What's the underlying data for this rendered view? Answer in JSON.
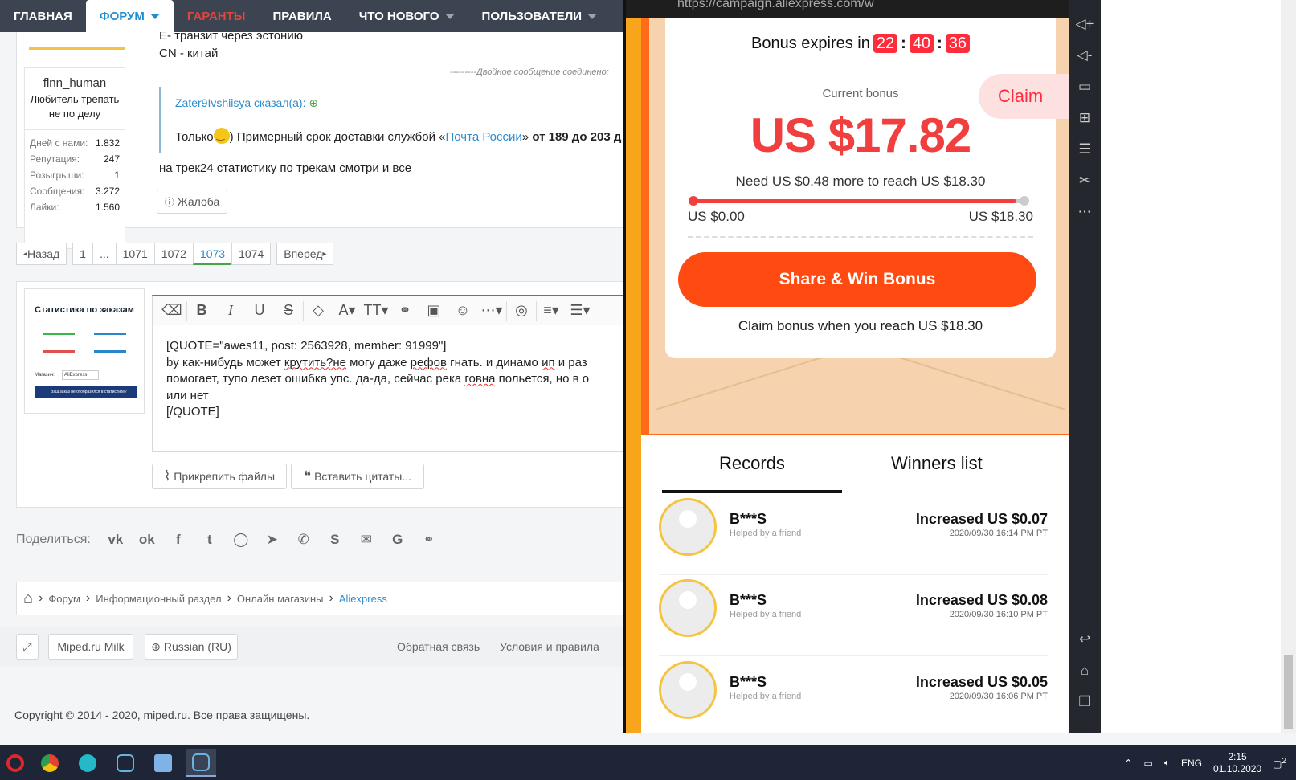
{
  "nav": {
    "items": [
      {
        "label": "ГЛАВНАЯ",
        "style": "normal",
        "caret": false
      },
      {
        "label": "ФОРУМ",
        "style": "active",
        "caret": true
      },
      {
        "label": "ГАРАНТЫ",
        "style": "red",
        "caret": false
      },
      {
        "label": "ПРАВИЛА",
        "style": "normal",
        "caret": false
      },
      {
        "label": "ЧТО НОВОГО",
        "style": "normal",
        "caret": true
      },
      {
        "label": "ПОЛЬЗОВАТЕЛИ",
        "style": "normal",
        "caret": true
      }
    ]
  },
  "post": {
    "line1": "E- транзит через эстонию",
    "line2": "CN - китай",
    "merged_note": "---------Двойное сообщение соединено:",
    "quote_author": "Zater9Ivshiisya сказал(а):",
    "quote_before": "Только",
    "quote_after": ") Примерный срок доставки службой «",
    "quote_link": "Почта России",
    "quote_tail": "» ",
    "quote_bold": "от 189 до 203 д",
    "reply": "на трек24 статистику по трекам смотри и все",
    "report_label": "Жалоба"
  },
  "user": {
    "name": "flnn_human",
    "title": "Любитель трепать не по делу",
    "stats": [
      {
        "key": "Дней с нами:",
        "value": "1.832"
      },
      {
        "key": "Репутация:",
        "value": "247"
      },
      {
        "key": "Розыгрыши:",
        "value": "1"
      },
      {
        "key": "Сообщения:",
        "value": "3.272"
      },
      {
        "key": "Лайки:",
        "value": "1.560"
      }
    ]
  },
  "pager": {
    "prev": "Назад",
    "pages": [
      "1",
      "...",
      "1071",
      "1072",
      "1073",
      "1074"
    ],
    "current": "1073",
    "next": "Вперед"
  },
  "thumb": {
    "title": "Статистика по заказам",
    "store_label": "Магазин:",
    "store_value": "AliExpress",
    "button": "Ваш заказ не отобразился в статистике?"
  },
  "editor": {
    "line1": "[QUOTE=\"awes11, post: 2563928, member: 91999\"]",
    "line2_a": "by как-нибудь может ",
    "line2_spell1": "крутить?не",
    "line2_b": " могу даже ",
    "line2_spell2": "рефов",
    "line2_c": " гнать. и динамо ",
    "line2_spell3": "ип",
    "line2_d": " и раз",
    "line3_a": "помогает, тупо лезет ошибка упс. да-да, сейчас река ",
    "line3_spell": "говна",
    "line3_b": " польется, но в о",
    "line4": "или нет",
    "line5": "[/QUOTE]",
    "attach_label": "Прикрепить файлы",
    "insert_quotes_label": "Вставить цитаты..."
  },
  "share": {
    "label": "Поделиться:",
    "icons": [
      "vk-icon",
      "odnoklassniki-icon",
      "facebook-icon",
      "twitter-icon",
      "whatsapp-icon",
      "telegram-icon",
      "viber-icon",
      "skype-icon",
      "email-icon",
      "google-icon",
      "link-icon"
    ]
  },
  "breadcrumb": [
    "Форум",
    "Информационный раздел",
    "Онлайн магазины",
    "Aliexpress"
  ],
  "footer": {
    "style_label": "Miped.ru Milk",
    "lang_label": "Russian (RU)",
    "feedback": "Обратная связь",
    "terms": "Условия и правила",
    "copyright": "Copyright © 2014 - 2020, miped.ru. Все права защищены."
  },
  "phone": {
    "url": "https://campaign.aliexpress.com/w",
    "bonus_expires": "Bonus expires in",
    "timer": [
      "22",
      "40",
      "36"
    ],
    "claim": "Claim",
    "current_bonus_label": "Current bonus",
    "amount": "US $17.82",
    "need_text": "Need US $0.48 more to reach US $18.30",
    "range_min": "US $0.00",
    "range_max": "US $18.30",
    "progress": 0.974,
    "share_button": "Share & Win Bonus",
    "claim_when": "Claim bonus when you reach US $18.30",
    "tabs": [
      "Records",
      "Winners list"
    ],
    "records": [
      {
        "name": "B***S",
        "sub": "Helped by a friend",
        "increase": "Increased US $0.07",
        "time": "2020/09/30 16:14 PM PT"
      },
      {
        "name": "B***S",
        "sub": "Helped by a friend",
        "increase": "Increased US $0.08",
        "time": "2020/09/30 16:10 PM PT"
      },
      {
        "name": "B***S",
        "sub": "Helped by a friend",
        "increase": "Increased US $0.05",
        "time": "2020/09/30 16:06 PM PT"
      }
    ]
  },
  "taskbar": {
    "lang": "ENG",
    "time": "2:15",
    "date": "01.10.2020",
    "notifications": "2"
  },
  "colors": {
    "accent_blue": "#1f8ed0",
    "ali_red": "#f13f3f",
    "ali_orange": "#ff4b12"
  }
}
